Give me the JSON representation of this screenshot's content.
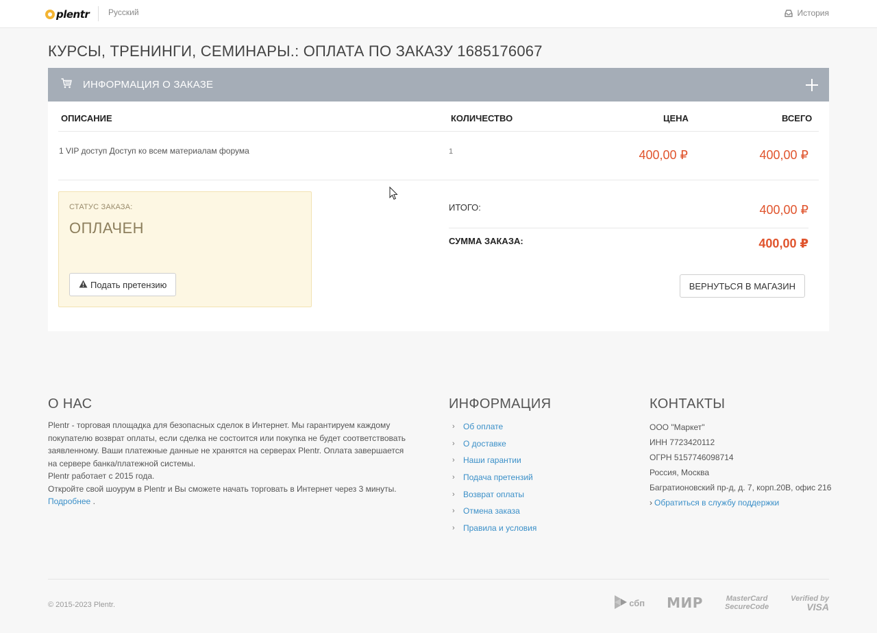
{
  "header": {
    "logo_text": "plentr",
    "language": "Русский",
    "history_label": "История"
  },
  "page": {
    "title": "КУРСЫ, ТРЕНИНГИ, СЕМИНАРЫ.: ОПЛАТА ПО ЗАКАЗУ 1685176067"
  },
  "order_panel": {
    "title": "ИНФОРМАЦИЯ О ЗАКАЗЕ",
    "columns": {
      "description": "ОПИСАНИЕ",
      "quantity": "КОЛИЧЕСТВО",
      "price": "ЦЕНА",
      "total": "ВСЕГО"
    },
    "items": [
      {
        "description": "1 VIP доступ Доступ ко всем материалам форума",
        "quantity": "1",
        "price": "400,00 ₽",
        "total": "400,00 ₽"
      }
    ],
    "status": {
      "label": "СТАТУС ЗАКАЗА:",
      "value": "ОПЛАЧЕН",
      "claim_button": "Подать претензию"
    },
    "summary": {
      "subtotal_label": "ИТОГО:",
      "subtotal_value": "400,00 ₽",
      "total_label": "СУММА ЗАКАЗА:",
      "total_value": "400,00 ₽",
      "back_button": "ВЕРНУТЬСЯ В МАГАЗИН"
    }
  },
  "footer": {
    "about": {
      "heading": "О НАС",
      "paragraph1": "Plentr - торговая площадка для безопасных сделок в Интернет. Мы гарантируем каждому покупателю возврат оплаты, если сделка не состоится или покупка не будет соответствовать заявленному. Ваши платежные данные не хранятся на серверах Plentr. Оплата завершается на сервере банка/платежной системы.",
      "paragraph2": "Plentr работает с 2015 года.",
      "paragraph3": "Откройте свой шоурум в Plentr и Вы сможете начать торговать в Интернет через 3 минуты.",
      "more_link": "Подробнее",
      "more_suffix": " ."
    },
    "info": {
      "heading": "ИНФОРМАЦИЯ",
      "links": [
        "Об оплате",
        "О доставке",
        "Наши гарантии",
        "Подача претензий",
        "Возврат оплаты",
        "Отмена заказа",
        "Правила и условия"
      ]
    },
    "contacts": {
      "heading": "КОНТАКТЫ",
      "company": "ООО \"Маркет\"",
      "inn": "ИНН 7723420112",
      "ogrn": "ОГРН 5157746098714",
      "city": "Россия, Москва",
      "address": "Багратионовский пр-д, д. 7, корп.20В, офис 216",
      "support_link": "Обратиться в службу поддержки"
    },
    "copyright": "© 2015-2023 Plentr.",
    "payment_logos": {
      "sbp": "сбп",
      "mir": "МИР",
      "mastercard_line1": "MasterCard",
      "mastercard_line2": "SecureCode",
      "visa_line1": "Verified by",
      "visa_line2": "VISA"
    }
  }
}
